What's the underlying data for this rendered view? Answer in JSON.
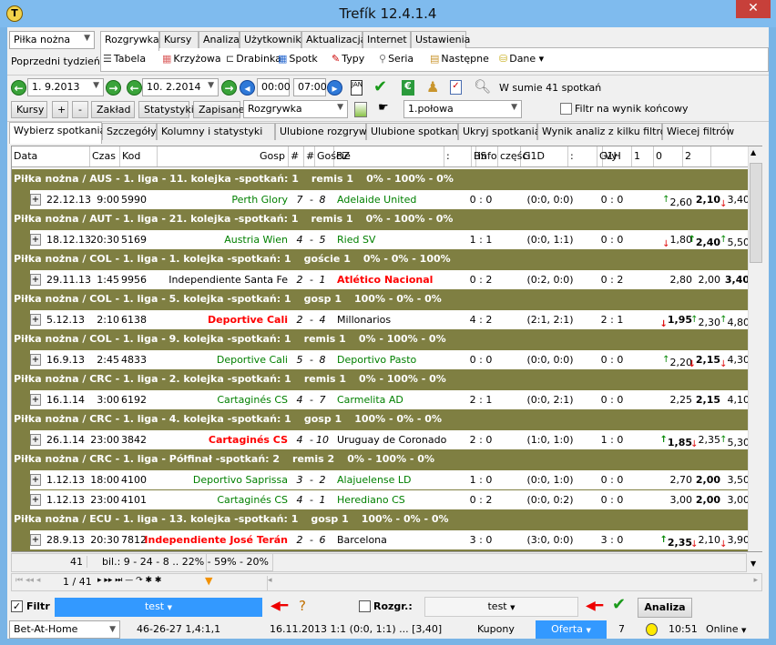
{
  "window": {
    "title": "Trefík 12.4.1.4",
    "close": "✕"
  },
  "sport_select": "Piłka nożna",
  "period_select": "Poprzedni tydzień",
  "menu_tabs": [
    "Rozgrywka",
    "Kursy",
    "Analiza",
    "Użytkownik",
    "Aktualizacja",
    "Internet",
    "Ustawienia"
  ],
  "toolbar": [
    "Tabela",
    "Krzyżowa",
    "Drabinka",
    "Spotk",
    "Typy",
    "Seria",
    "Następne",
    "Dane"
  ],
  "date_from": "1.  9.2013",
  "date_to": "10.  2.2014",
  "time_from": "00:00",
  "time_to": "07:00",
  "summary": "W sumie 41 spotkań",
  "buttons": {
    "kursy": "Kursy",
    "plus": "+",
    "minus": "-",
    "zaklad": "Zakład",
    "statystyki": "Statystyki",
    "zapisane": "Zapisane",
    "analiza": "Analiza"
  },
  "mode_select": "Rozgrywka",
  "half_select": "1.połowa",
  "filter_final": "Filtr na wynik końcowy",
  "sub_tabs": [
    "Wybierz spotkania",
    "Szczegóły",
    "Kolumny i statystyki",
    "Ulubione rozgrywki",
    "Ulubione spotkania",
    "Ukryj spotkania",
    "Wynik analiz z kilku filtrów",
    "Wiecej filtrów"
  ],
  "columns": [
    "Data",
    "Czas",
    "Kod",
    "Gosp",
    "#",
    "#",
    "Goście",
    "BZ",
    ":",
    "BS",
    "info",
    "części",
    "G1D",
    ":",
    "G1H",
    "Vy",
    "1",
    "0",
    "2"
  ],
  "colors": {
    "group": "#7f7f42",
    "green": "#008000",
    "red": "#ff0000",
    "accent": "#3399ff"
  },
  "groups": [
    {
      "title": "Piłka nożna / AUS - 1. liga - 11. kolejka -spotkań: 1",
      "res": "remis 1",
      "pct": "0% - 100% - 0%",
      "rows": [
        {
          "date": "22.12.13",
          "time": "9:00",
          "code": "5990",
          "home": "Perth Glory",
          "hc": "green",
          "hs": "7",
          "as": "8",
          "away": "Adelaide United",
          "ac": "green",
          "bz": "0 : 0",
          "parts": "(0:0, 0:0)",
          "g1": "0 : 0",
          "odds": [
            {
              "v": "2,60",
              "a": "up"
            },
            {
              "v": "2,10",
              "b": true
            },
            {
              "v": "3,40",
              "a": "down"
            }
          ]
        }
      ]
    },
    {
      "title": "Piłka nożna / AUT - 1. liga - 21. kolejka -spotkań: 1",
      "res": "remis 1",
      "pct": "0% - 100% - 0%",
      "rows": [
        {
          "date": "18.12.13",
          "time": "20:30",
          "code": "5169",
          "home": "Austria Wien",
          "hc": "green",
          "hs": "4",
          "as": "5",
          "away": "Ried SV",
          "ac": "green",
          "bz": "1 : 1",
          "parts": "(0:0, 1:1)",
          "g1": "0 : 0",
          "odds": [
            {
              "v": "1,80",
              "a": "down"
            },
            {
              "v": "2,40",
              "b": true,
              "a": "up"
            },
            {
              "v": "5,50",
              "a": "up"
            }
          ]
        }
      ]
    },
    {
      "title": "Piłka nożna / COL - 1. liga - 1. kolejka -spotkań: 1",
      "res": "goście 1",
      "pct": "0% - 0% - 100%",
      "rows": [
        {
          "date": "29.11.13",
          "time": "1:45",
          "code": "9956",
          "home": "Independiente Santa Fe",
          "hc": "black",
          "hs": "2",
          "as": "1",
          "away": "Atlético Nacional",
          "ac": "red",
          "bz": "0 : 2",
          "parts": "(0:2, 0:0)",
          "g1": "0 : 2",
          "odds": [
            {
              "v": "2,80"
            },
            {
              "v": "2,00"
            },
            {
              "v": "3,40",
              "b": true
            }
          ]
        }
      ]
    },
    {
      "title": "Piłka nożna / COL - 1. liga - 5. kolejka -spotkań: 1",
      "res": "gosp 1",
      "pct": "100% - 0% - 0%",
      "rows": [
        {
          "date": "5.12.13",
          "time": "2:10",
          "code": "6138",
          "home": "Deportive Cali",
          "hc": "red",
          "hs": "2",
          "as": "4",
          "away": "Millonarios",
          "ac": "black",
          "bz": "4 : 2",
          "parts": "(2:1, 2:1)",
          "g1": "2 : 1",
          "odds": [
            {
              "v": "1,95",
              "b": true,
              "a": "down"
            },
            {
              "v": "2,30",
              "a": "up"
            },
            {
              "v": "4,80",
              "a": "up"
            }
          ]
        }
      ]
    },
    {
      "title": "Piłka nożna / COL - 1. liga - 9. kolejka -spotkań: 1",
      "res": "remis 1",
      "pct": "0% - 100% - 0%",
      "rows": [
        {
          "date": "16.9.13",
          "time": "2:45",
          "code": "4833",
          "home": "Deportive Cali",
          "hc": "green",
          "hs": "5",
          "as": "8",
          "away": "Deportivo Pasto",
          "ac": "green",
          "bz": "0 : 0",
          "parts": "(0:0, 0:0)",
          "g1": "0 : 0",
          "odds": [
            {
              "v": "2,20",
              "a": "up"
            },
            {
              "v": "2,15",
              "b": true,
              "a": "down"
            },
            {
              "v": "4,30",
              "a": "down"
            }
          ]
        }
      ]
    },
    {
      "title": "Piłka nożna / CRC - 1. liga - 2. kolejka -spotkań: 1",
      "res": "remis 1",
      "pct": "0% - 100% - 0%",
      "rows": [
        {
          "date": "16.1.14",
          "time": "3:00",
          "code": "6192",
          "home": "Cartaginés CS",
          "hc": "green",
          "hs": "4",
          "as": "7",
          "away": "Carmelita AD",
          "ac": "green",
          "bz": "2 : 1",
          "parts": "(0:0, 2:1)",
          "g1": "0 : 0",
          "odds": [
            {
              "v": "2,25"
            },
            {
              "v": "2,15",
              "b": true
            },
            {
              "v": "4,10"
            }
          ]
        }
      ]
    },
    {
      "title": "Piłka nożna / CRC - 1. liga - 4. kolejka -spotkań: 1",
      "res": "gosp 1",
      "pct": "100% - 0% - 0%",
      "rows": [
        {
          "date": "26.1.14",
          "time": "23:00",
          "code": "3842",
          "home": "Cartaginés CS",
          "hc": "red",
          "hs": "4",
          "as": "10",
          "away": "Uruguay de Coronado",
          "ac": "black",
          "bz": "2 : 0",
          "parts": "(1:0, 1:0)",
          "g1": "1 : 0",
          "odds": [
            {
              "v": "1,85",
              "b": true,
              "a": "up"
            },
            {
              "v": "2,35",
              "a": "down"
            },
            {
              "v": "5,30",
              "a": "up"
            }
          ]
        }
      ]
    },
    {
      "title": "Piłka nożna / CRC - 1. liga - Półfinał -spotkań: 2",
      "res": "remis 2",
      "pct": "0% - 100% - 0%",
      "rows": [
        {
          "date": "1.12.13",
          "time": "18:00",
          "code": "4100",
          "home": "Deportivo Saprissa",
          "hc": "green",
          "hs": "3",
          "as": "2",
          "away": "Alajuelense LD",
          "ac": "green",
          "bz": "1 : 0",
          "parts": "(0:0, 1:0)",
          "g1": "0 : 0",
          "odds": [
            {
              "v": "2,70"
            },
            {
              "v": "2,00",
              "b": true
            },
            {
              "v": "3,50"
            }
          ]
        },
        {
          "date": "1.12.13",
          "time": "23:00",
          "code": "4101",
          "home": "Cartaginés CS",
          "hc": "green",
          "hs": "4",
          "as": "1",
          "away": "Herediano CS",
          "ac": "green",
          "bz": "0 : 2",
          "parts": "(0:0, 0:2)",
          "g1": "0 : 0",
          "odds": [
            {
              "v": "3,00"
            },
            {
              "v": "2,00",
              "b": true
            },
            {
              "v": "3,00"
            }
          ]
        }
      ]
    },
    {
      "title": "Piłka nożna / ECU - 1. liga - 13. kolejka -spotkań: 1",
      "res": "gosp 1",
      "pct": "100% - 0% - 0%",
      "rows": [
        {
          "date": "28.9.13",
          "time": "20:30",
          "code": "7812",
          "home": "Independiente José Terán",
          "hc": "red",
          "hs": "2",
          "as": "6",
          "away": "Barcelona",
          "ac": "black",
          "bz": "3 : 0",
          "parts": "(3:0, 0:0)",
          "g1": "3 : 0",
          "odds": [
            {
              "v": "2,35",
              "b": true,
              "a": "up"
            },
            {
              "v": "2,10",
              "a": "down"
            },
            {
              "v": "3,90",
              "a": "down"
            }
          ]
        }
      ]
    }
  ],
  "footer": {
    "count": "41",
    "bil": "bil.: 9 - 24 - 8 .. 22% - 59% - 20%",
    "page": "1 / 41"
  },
  "filter": {
    "label": "Filtr",
    "checked": true,
    "value": "test",
    "rozgr_label": "Rozgr.:",
    "rozgr_checked": false,
    "rozgr_value": "test"
  },
  "status": {
    "bookmaker": "Bet-At-Home",
    "stats": "46-26-27  1,4:1,1",
    "last": "16.11.2013 1:1 (0:0, 1:1) ... [3,40]",
    "kupony": "Kupony",
    "oferta": "Oferta",
    "count": "7",
    "time": "10:51",
    "online": "Online"
  }
}
